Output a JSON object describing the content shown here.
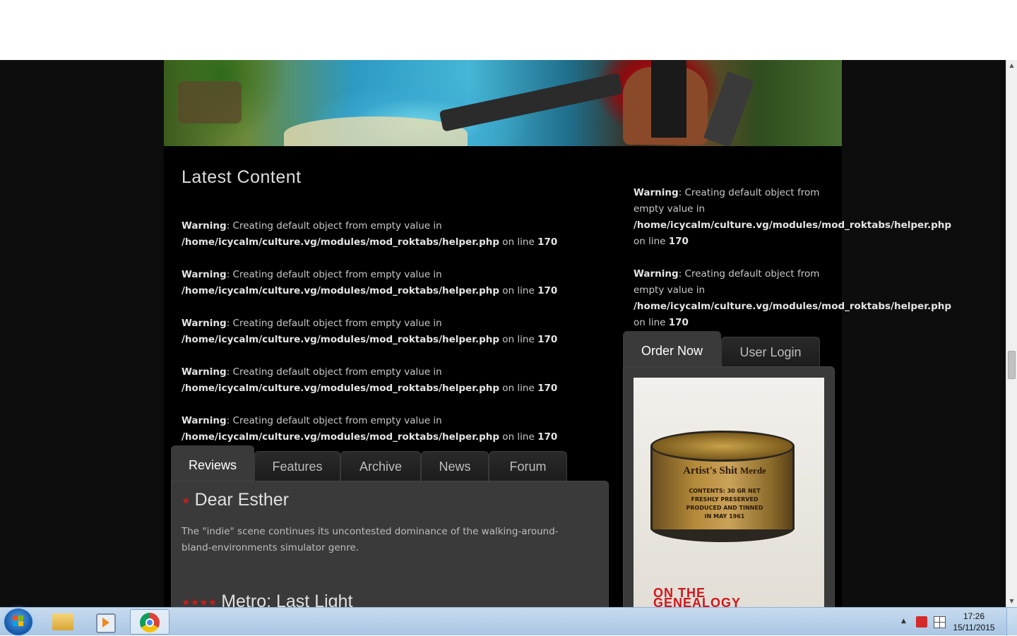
{
  "latest": {
    "title": "Latest Content",
    "warnings": [
      {
        "label": "Warning",
        "msg": ": Creating default object from empty value in",
        "path": "/home/icycalm/culture.vg/modules/mod_roktabs/helper.php",
        "online": " on line ",
        "line": "170"
      },
      {
        "label": "Warning",
        "msg": ": Creating default object from empty value in",
        "path": "/home/icycalm/culture.vg/modules/mod_roktabs/helper.php",
        "online": " on line ",
        "line": "170"
      },
      {
        "label": "Warning",
        "msg": ": Creating default object from empty value in",
        "path": "/home/icycalm/culture.vg/modules/mod_roktabs/helper.php",
        "online": " on line ",
        "line": "170"
      },
      {
        "label": "Warning",
        "msg": ": Creating default object from empty value in",
        "path": "/home/icycalm/culture.vg/modules/mod_roktabs/helper.php",
        "online": " on line ",
        "line": "170"
      },
      {
        "label": "Warning",
        "msg": ": Creating default object from empty value in",
        "path": "/home/icycalm/culture.vg/modules/mod_roktabs/helper.php",
        "online": " on line ",
        "line": "170"
      }
    ]
  },
  "sidebar_warnings": [
    {
      "label": "Warning",
      "msg1": ": Creating default object from",
      "msg2": "empty value in",
      "path": "/home/icycalm/culture.vg/modules/mod_roktabs/helper.php",
      "online": "on line ",
      "line": "170"
    },
    {
      "label": "Warning",
      "msg1": ": Creating default object from",
      "msg2": "empty value in",
      "path": "/home/icycalm/culture.vg/modules/mod_roktabs/helper.php",
      "online": "on line ",
      "line": "170"
    }
  ],
  "content_tabs": [
    "Reviews",
    "Features",
    "Archive",
    "News",
    "Forum"
  ],
  "reviews": [
    {
      "stars": "★",
      "title": "Dear Esther",
      "desc": "The \"indie\" scene continues its uncontested dominance of the walking-around-bland-environments simulator genre."
    },
    {
      "stars": "★★★★",
      "title": "Metro: Last Light",
      "desc": ""
    }
  ],
  "side_tabs": [
    "Order Now",
    "User Login"
  ],
  "product": {
    "can_label_1": "Artist's Shit",
    "can_label_2": "Merde",
    "can_small": "CONTENTS: 30 GR NET\nFRESHLY PRESERVED\nPRODUCED AND TINNED\nIN MAY 1961",
    "book_title": "ON THE\nGENEALOGY"
  },
  "taskbar": {
    "time": "17:26",
    "date": "15/11/2015"
  },
  "colors": {
    "page_bg": "#000000",
    "panel_bg": "#3a3a3a",
    "star_red": "#c81e1e"
  }
}
